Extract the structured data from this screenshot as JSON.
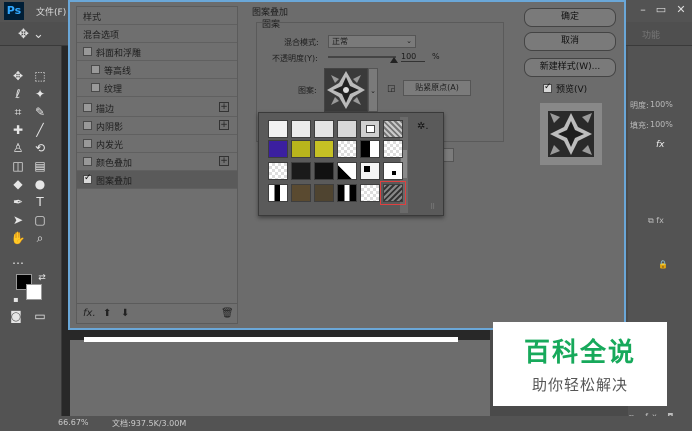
{
  "app": {
    "logo": "Ps",
    "menu_file": "文件(F)"
  },
  "options_bar": {
    "right_label": "功能"
  },
  "status_bar": {
    "zoom": "66.67%",
    "doc_size": "文档:937.5K/3.00M"
  },
  "right_panel": {
    "opacity_label": "明度:",
    "opacity_value": "100%",
    "fill_label": "填充:",
    "fill_value": "100%",
    "fx_label": "fx"
  },
  "dialog": {
    "styles_heading": "样式",
    "blend_options": "混合选项",
    "style_items": [
      {
        "label": "斜面和浮雕",
        "checked": false,
        "plus": false
      },
      {
        "label": "等高线",
        "checked": false,
        "plus": false
      },
      {
        "label": "纹理",
        "checked": false,
        "plus": false
      },
      {
        "label": "描边",
        "checked": false,
        "plus": true
      },
      {
        "label": "内阴影",
        "checked": false,
        "plus": true
      },
      {
        "label": "内发光",
        "checked": false,
        "plus": false
      },
      {
        "label": "颜色叠加",
        "checked": false,
        "plus": true
      },
      {
        "label": "图案叠加",
        "checked": true,
        "plus": false
      }
    ],
    "pattern_overlay_title": "图案叠加",
    "pattern_group_title": "图案",
    "blend_mode_label": "混合模式:",
    "blend_mode_value": "正常",
    "opacity_label": "不透明度(Y):",
    "opacity_value": "100",
    "opacity_unit": "%",
    "pattern_label": "图案:",
    "snap_origin_button": "贴紧原点(A)",
    "ok_button": "确定",
    "cancel_button": "取消",
    "new_style_button": "新建样式(W)...",
    "preview_label": "预览(V)"
  },
  "watermark": {
    "title": "百科全说",
    "subtitle": "助你轻松解决"
  }
}
